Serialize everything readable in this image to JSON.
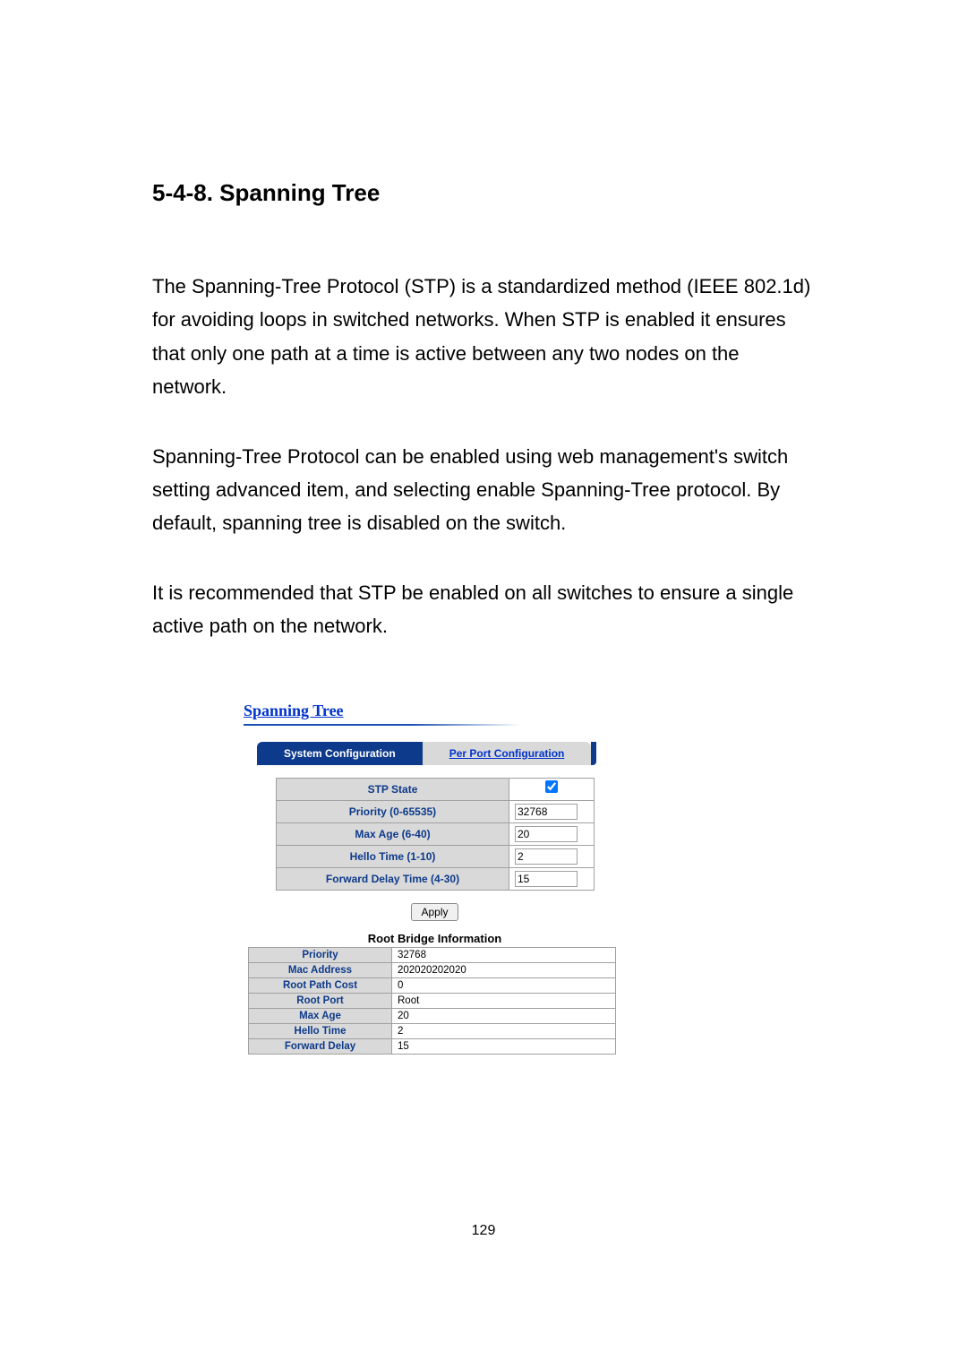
{
  "doc": {
    "section_title": "5-4-8. Spanning Tree",
    "para1": "The Spanning-Tree Protocol (STP) is a standardized method (IEEE 802.1d) for avoiding loops in switched networks. When STP is enabled it ensures that only one path at a time is active between any two nodes on the network.",
    "para2": "Spanning-Tree Protocol can be enabled using web management's switch setting advanced item, and selecting enable Spanning-Tree protocol. By default, spanning tree is disabled on the switch.",
    "para3": "It is recommended that STP be enabled on all switches to ensure a single active path on the network.",
    "page_number": "129"
  },
  "ui": {
    "panel_title": "Spanning Tree",
    "tabs": {
      "system": "System Configuration",
      "perport": "Per Port Configuration"
    },
    "config": {
      "rows": [
        {
          "label": "STP State",
          "type": "checkbox",
          "checked": true
        },
        {
          "label": "Priority (0-65535)",
          "type": "text",
          "value": "32768"
        },
        {
          "label": "Max Age (6-40)",
          "type": "text",
          "value": "20"
        },
        {
          "label": "Hello Time (1-10)",
          "type": "text",
          "value": "2"
        },
        {
          "label": "Forward Delay Time (4-30)",
          "type": "text",
          "value": "15"
        }
      ]
    },
    "apply_label": "Apply",
    "info_title": "Root Bridge Information",
    "info": [
      {
        "label": "Priority",
        "value": "32768"
      },
      {
        "label": "Mac Address",
        "value": "202020202020"
      },
      {
        "label": "Root Path Cost",
        "value": "0"
      },
      {
        "label": "Root Port",
        "value": "Root"
      },
      {
        "label": "Max Age",
        "value": "20"
      },
      {
        "label": "Hello Time",
        "value": "2"
      },
      {
        "label": "Forward Delay",
        "value": "15"
      }
    ]
  }
}
